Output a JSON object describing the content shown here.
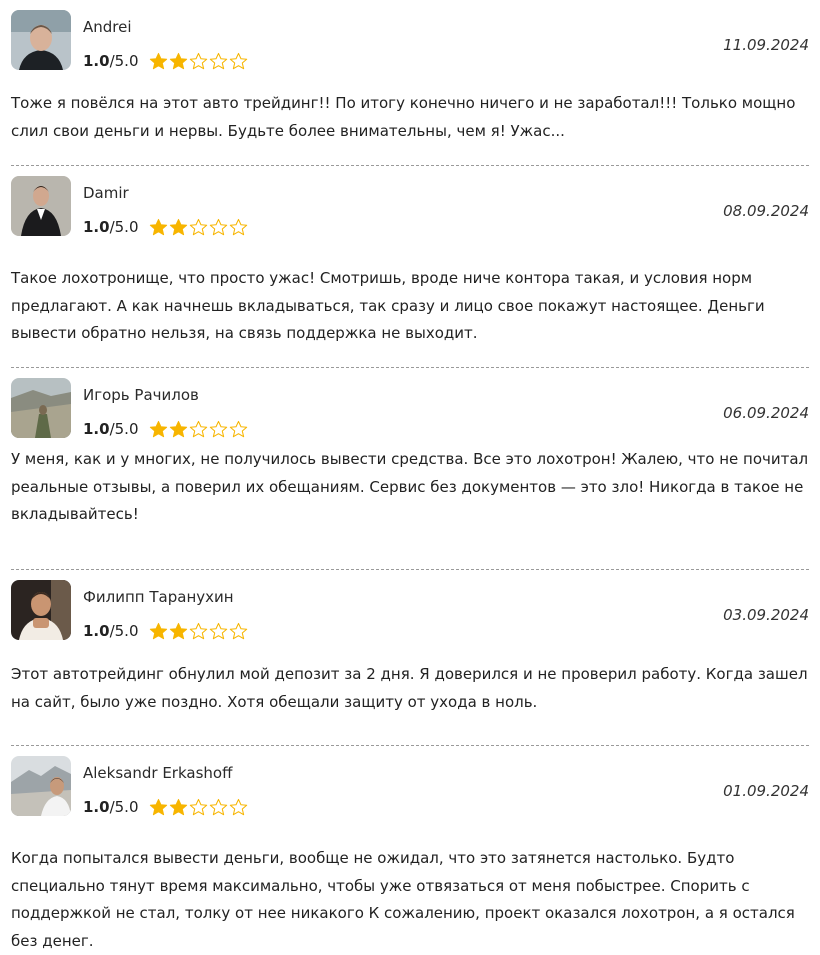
{
  "colors": {
    "star_filled": "#f7b500",
    "star_empty": "#f7b500",
    "divider": "#9a9a9a"
  },
  "reviews": [
    {
      "author": "Andrei",
      "rating": "1.0",
      "rating_max": "/5.0",
      "stars_filled": 2,
      "stars_total": 5,
      "date": "11.09.2024",
      "avatar_icon": "user-photo-icon",
      "text": "Тоже я повёлся на этот авто трейдинг!! По итогу конечно ничего и не заработал!!! Только мощно слил свои деньги и нервы. Будьте более внимательны, чем я! Ужас..."
    },
    {
      "author": "Damir",
      "rating": "1.0",
      "rating_max": "/5.0",
      "stars_filled": 2,
      "stars_total": 5,
      "date": "08.09.2024",
      "avatar_icon": "user-photo-icon",
      "text": "Такое лохотронище, что просто ужас! Смотришь, вроде ниче контора такая, и условия норм предлагают. А как начнешь вкладываться, так сразу и лицо свое покажут настоящее. Деньги вывести обратно нельзя, на связь поддержка не выходит."
    },
    {
      "author": "Игорь Рачилов",
      "rating": "1.0",
      "rating_max": "/5.0",
      "stars_filled": 2,
      "stars_total": 5,
      "date": "06.09.2024",
      "avatar_icon": "user-photo-icon",
      "text": "У меня, как и у многих, не получилось вывести средства. Все это лохотрон! Жалею, что не почитал реальные отзывы, а поверил их обещаниям. Сервис без документов — это зло! Никогда в такое не вкладывайтесь!"
    },
    {
      "author": "Филипп Таранухин",
      "rating": "1.0",
      "rating_max": "/5.0",
      "stars_filled": 2,
      "stars_total": 5,
      "date": "03.09.2024",
      "avatar_icon": "user-photo-icon",
      "text": "Этот автотрейдинг обнулил мой депозит за 2 дня. Я доверился и не проверил работу. Когда зашел на сайт, было уже поздно. Хотя обещали защиту от ухода в ноль."
    },
    {
      "author": "Aleksandr Erkashoff",
      "rating": "1.0",
      "rating_max": "/5.0",
      "stars_filled": 2,
      "stars_total": 5,
      "date": "01.09.2024",
      "avatar_icon": "user-photo-icon",
      "text": "Когда попытался вывести деньги, вообще не ожидал, что это затянется настолько. Будто специально тянут время максимально, чтобы уже отвязаться от меня побыстрее. Спорить с поддержкой не стал, толку от нее никакого К сожалению, проект оказался лохотрон, а я остался без денег."
    }
  ]
}
